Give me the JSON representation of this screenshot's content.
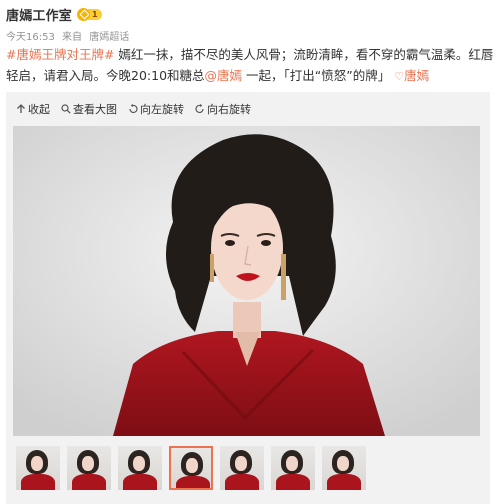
{
  "post": {
    "author": "唐嫣工作室",
    "vip_level": "1",
    "time": "今天16:53",
    "source_prefix": "来自",
    "source": "唐嫣超话",
    "text_line1_topic": "#唐嫣王牌对王牌#",
    "text_line1_rest": " 嫣红一抹，描不尽的美人风骨；流盼清眸，看不穿的霸气温柔。红唇",
    "text_line2_start": "轻启，请君入局。今晚20:10和糖总",
    "mention": "@唐嫣",
    "text_line2_mid": " 一起，「打出“愤怒”的牌」",
    "super_topic_link": "唐嫣"
  },
  "gallery": {
    "tools": {
      "collapse": "收起",
      "view_large": "查看大图",
      "rotate_left": "向左旋转",
      "rotate_right": "向右旋转"
    },
    "thumbnails": [
      {
        "active": false
      },
      {
        "active": false
      },
      {
        "active": false
      },
      {
        "active": true
      },
      {
        "active": false
      },
      {
        "active": false
      },
      {
        "active": false
      }
    ]
  },
  "colors": {
    "link": "#eb7350",
    "dress": "#a9141d",
    "vip_badge": "#f5b400"
  }
}
